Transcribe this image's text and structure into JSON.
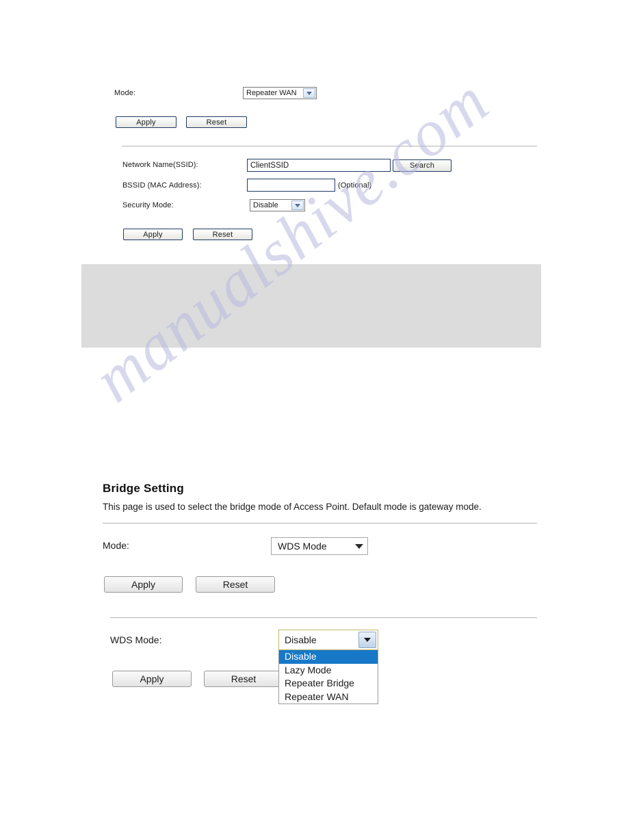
{
  "watermark": {
    "text": "manualshive.com"
  },
  "section_top": {
    "mode_label": "Mode:",
    "mode_value": "Repeater WAN",
    "mode_options": [
      "Repeater WAN"
    ],
    "apply_label": "Apply",
    "reset_label": "Reset",
    "ssid_label": "Network Name(SSID):",
    "ssid_value": "ClientSSID",
    "search_label": "Search",
    "bssid_label": "BSSID (MAC Address):",
    "bssid_value": "",
    "bssid_optional": "(Optional)",
    "security_label": "Security Mode:",
    "security_value": "Disable",
    "apply2_label": "Apply",
    "reset2_label": "Reset"
  },
  "section_bottom": {
    "title": "Bridge Setting",
    "description": "This page is used to select the bridge mode of Access Point. Default mode is gateway mode.",
    "mode_label": "Mode:",
    "mode_value": "WDS Mode",
    "apply_label": "Apply",
    "reset_label": "Reset",
    "wds_label": "WDS Mode:",
    "wds_value": "Disable",
    "wds_options": [
      {
        "label": "Disable",
        "selected": true
      },
      {
        "label": "Lazy Mode",
        "selected": false
      },
      {
        "label": "Repeater Bridge",
        "selected": false
      },
      {
        "label": "Repeater WAN",
        "selected": false
      }
    ],
    "apply2_label": "Apply",
    "reset2_label": "Reset"
  },
  "colors": {
    "highlight_blue": "#1778c8",
    "grey_block": "#dcdcdc",
    "watermark": "#b9b9e0"
  }
}
